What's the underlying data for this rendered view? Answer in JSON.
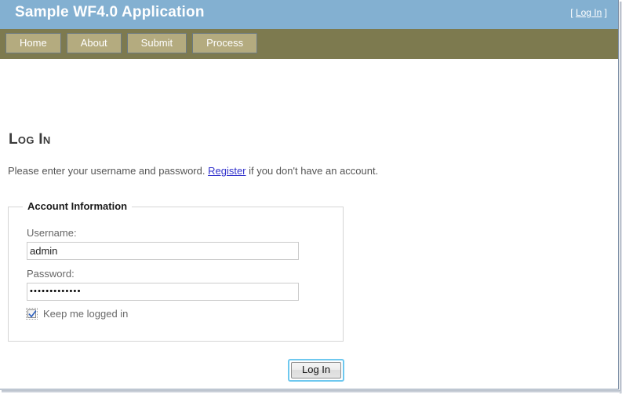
{
  "header": {
    "app_title": "Sample WF4.0 Application",
    "login_status_prefix": "[ ",
    "login_status_link": "Log In",
    "login_status_suffix": " ]"
  },
  "nav": {
    "items": [
      {
        "label": "Home"
      },
      {
        "label": "About"
      },
      {
        "label": "Submit"
      },
      {
        "label": "Process"
      }
    ]
  },
  "main": {
    "page_title": "Log In",
    "intro_before": "Please enter your username and password. ",
    "intro_link": "Register",
    "intro_after": " if you don't have an account."
  },
  "form": {
    "legend": "Account Information",
    "username_label": "Username:",
    "username_value": "admin",
    "username_placeholder": "",
    "password_label": "Password:",
    "password_value": "•••••••••••••",
    "password_placeholder": "",
    "remember_label": "Keep me logged in",
    "remember_checked": "true",
    "submit_label": "Log In"
  },
  "colors": {
    "header_blue": "#83b0d1",
    "nav_olive": "#7d7a4f",
    "tab_fill": "#b4ab7f",
    "tab_border": "#6d7a80",
    "link_blue": "#3333cc",
    "focus_ring": "#6ec8ef",
    "fieldset_border": "#d5d5d5",
    "input_border": "#cccccc"
  }
}
